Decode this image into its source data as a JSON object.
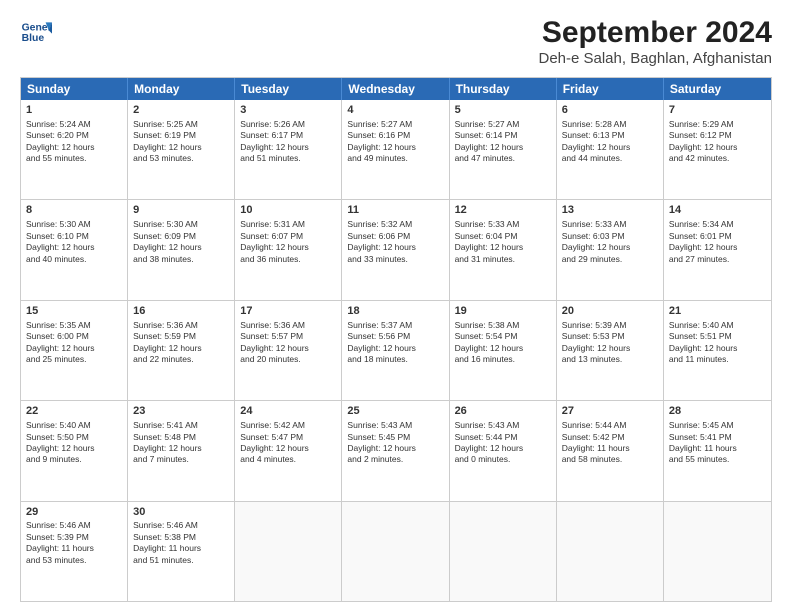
{
  "logo": {
    "line1": "General",
    "line2": "Blue"
  },
  "title": "September 2024",
  "subtitle": "Deh-e Salah, Baghlan, Afghanistan",
  "headers": [
    "Sunday",
    "Monday",
    "Tuesday",
    "Wednesday",
    "Thursday",
    "Friday",
    "Saturday"
  ],
  "rows": [
    [
      {
        "day": "",
        "content": ""
      },
      {
        "day": "2",
        "content": "Sunrise: 5:25 AM\nSunset: 6:19 PM\nDaylight: 12 hours\nand 53 minutes."
      },
      {
        "day": "3",
        "content": "Sunrise: 5:26 AM\nSunset: 6:17 PM\nDaylight: 12 hours\nand 51 minutes."
      },
      {
        "day": "4",
        "content": "Sunrise: 5:27 AM\nSunset: 6:16 PM\nDaylight: 12 hours\nand 49 minutes."
      },
      {
        "day": "5",
        "content": "Sunrise: 5:27 AM\nSunset: 6:14 PM\nDaylight: 12 hours\nand 47 minutes."
      },
      {
        "day": "6",
        "content": "Sunrise: 5:28 AM\nSunset: 6:13 PM\nDaylight: 12 hours\nand 44 minutes."
      },
      {
        "day": "7",
        "content": "Sunrise: 5:29 AM\nSunset: 6:12 PM\nDaylight: 12 hours\nand 42 minutes."
      }
    ],
    [
      {
        "day": "1",
        "content": "Sunrise: 5:24 AM\nSunset: 6:20 PM\nDaylight: 12 hours\nand 55 minutes."
      },
      {
        "day": "9",
        "content": "Sunrise: 5:30 AM\nSunset: 6:09 PM\nDaylight: 12 hours\nand 38 minutes."
      },
      {
        "day": "10",
        "content": "Sunrise: 5:31 AM\nSunset: 6:07 PM\nDaylight: 12 hours\nand 36 minutes."
      },
      {
        "day": "11",
        "content": "Sunrise: 5:32 AM\nSunset: 6:06 PM\nDaylight: 12 hours\nand 33 minutes."
      },
      {
        "day": "12",
        "content": "Sunrise: 5:33 AM\nSunset: 6:04 PM\nDaylight: 12 hours\nand 31 minutes."
      },
      {
        "day": "13",
        "content": "Sunrise: 5:33 AM\nSunset: 6:03 PM\nDaylight: 12 hours\nand 29 minutes."
      },
      {
        "day": "14",
        "content": "Sunrise: 5:34 AM\nSunset: 6:01 PM\nDaylight: 12 hours\nand 27 minutes."
      }
    ],
    [
      {
        "day": "8",
        "content": "Sunrise: 5:30 AM\nSunset: 6:10 PM\nDaylight: 12 hours\nand 40 minutes."
      },
      {
        "day": "16",
        "content": "Sunrise: 5:36 AM\nSunset: 5:59 PM\nDaylight: 12 hours\nand 22 minutes."
      },
      {
        "day": "17",
        "content": "Sunrise: 5:36 AM\nSunset: 5:57 PM\nDaylight: 12 hours\nand 20 minutes."
      },
      {
        "day": "18",
        "content": "Sunrise: 5:37 AM\nSunset: 5:56 PM\nDaylight: 12 hours\nand 18 minutes."
      },
      {
        "day": "19",
        "content": "Sunrise: 5:38 AM\nSunset: 5:54 PM\nDaylight: 12 hours\nand 16 minutes."
      },
      {
        "day": "20",
        "content": "Sunrise: 5:39 AM\nSunset: 5:53 PM\nDaylight: 12 hours\nand 13 minutes."
      },
      {
        "day": "21",
        "content": "Sunrise: 5:40 AM\nSunset: 5:51 PM\nDaylight: 12 hours\nand 11 minutes."
      }
    ],
    [
      {
        "day": "15",
        "content": "Sunrise: 5:35 AM\nSunset: 6:00 PM\nDaylight: 12 hours\nand 25 minutes."
      },
      {
        "day": "23",
        "content": "Sunrise: 5:41 AM\nSunset: 5:48 PM\nDaylight: 12 hours\nand 7 minutes."
      },
      {
        "day": "24",
        "content": "Sunrise: 5:42 AM\nSunset: 5:47 PM\nDaylight: 12 hours\nand 4 minutes."
      },
      {
        "day": "25",
        "content": "Sunrise: 5:43 AM\nSunset: 5:45 PM\nDaylight: 12 hours\nand 2 minutes."
      },
      {
        "day": "26",
        "content": "Sunrise: 5:43 AM\nSunset: 5:44 PM\nDaylight: 12 hours\nand 0 minutes."
      },
      {
        "day": "27",
        "content": "Sunrise: 5:44 AM\nSunset: 5:42 PM\nDaylight: 11 hours\nand 58 minutes."
      },
      {
        "day": "28",
        "content": "Sunrise: 5:45 AM\nSunset: 5:41 PM\nDaylight: 11 hours\nand 55 minutes."
      }
    ],
    [
      {
        "day": "22",
        "content": "Sunrise: 5:40 AM\nSunset: 5:50 PM\nDaylight: 12 hours\nand 9 minutes."
      },
      {
        "day": "30",
        "content": "Sunrise: 5:46 AM\nSunset: 5:38 PM\nDaylight: 11 hours\nand 51 minutes."
      },
      {
        "day": "",
        "content": ""
      },
      {
        "day": "",
        "content": ""
      },
      {
        "day": "",
        "content": ""
      },
      {
        "day": "",
        "content": ""
      },
      {
        "day": "",
        "content": ""
      }
    ],
    [
      {
        "day": "29",
        "content": "Sunrise: 5:46 AM\nSunset: 5:39 PM\nDaylight: 11 hours\nand 53 minutes."
      },
      {
        "day": "",
        "content": ""
      },
      {
        "day": "",
        "content": ""
      },
      {
        "day": "",
        "content": ""
      },
      {
        "day": "",
        "content": ""
      },
      {
        "day": "",
        "content": ""
      },
      {
        "day": "",
        "content": ""
      }
    ]
  ]
}
